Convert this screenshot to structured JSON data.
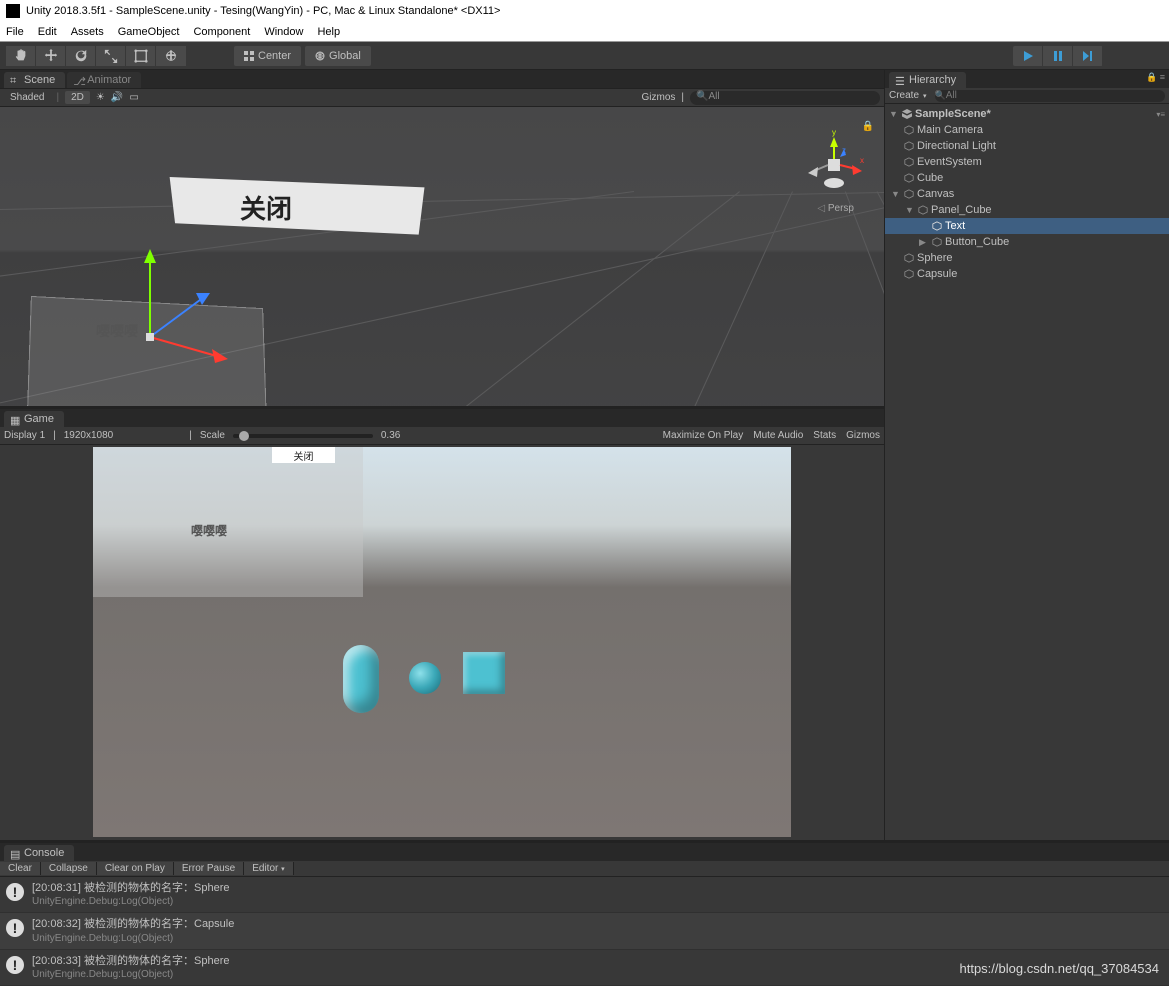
{
  "window": {
    "title": "Unity 2018.3.5f1 - SampleScene.unity - Tesing(WangYin) - PC, Mac & Linux Standalone* <DX11>"
  },
  "menu": {
    "file": "File",
    "edit": "Edit",
    "assets": "Assets",
    "gameobject": "GameObject",
    "component": "Component",
    "window": "Window",
    "help": "Help"
  },
  "toolbar": {
    "center": "Center",
    "global": "Global"
  },
  "tabs": {
    "scene": "Scene",
    "animator": "Animator",
    "game": "Game",
    "hierarchy": "Hierarchy",
    "console": "Console"
  },
  "scene_toolbar": {
    "shaded": "Shaded",
    "twoD": "2D",
    "gizmos": "Gizmos",
    "all_placeholder": "All",
    "persp": "Persp"
  },
  "scene_content": {
    "close_button": "关闭",
    "panel_text": "嘤嘤嘤"
  },
  "game_toolbar": {
    "display": "Display 1",
    "resolution": "1920x1080",
    "scale_label": "Scale",
    "scale_value": "0.36",
    "maximize": "Maximize On Play",
    "mute": "Mute Audio",
    "stats": "Stats",
    "gizmos": "Gizmos"
  },
  "game_content": {
    "close_button": "关闭",
    "panel_text": "嘤嘤嘤"
  },
  "hierarchy_toolbar": {
    "create": "Create",
    "all_placeholder": "All"
  },
  "hierarchy": {
    "scene": "SampleScene*",
    "items": [
      {
        "name": "Main Camera"
      },
      {
        "name": "Directional Light"
      },
      {
        "name": "EventSystem"
      },
      {
        "name": "Cube"
      },
      {
        "name": "Canvas"
      },
      {
        "name": "Panel_Cube"
      },
      {
        "name": "Text"
      },
      {
        "name": "Button_Cube"
      },
      {
        "name": "Sphere"
      },
      {
        "name": "Capsule"
      }
    ]
  },
  "console_toolbar": {
    "clear": "Clear",
    "collapse": "Collapse",
    "clear_on_play": "Clear on Play",
    "error_pause": "Error Pause",
    "editor": "Editor"
  },
  "console": {
    "logs": [
      {
        "time": "[20:08:31]",
        "msg": "被检测的物体的名字：Sphere",
        "src": "UnityEngine.Debug:Log(Object)"
      },
      {
        "time": "[20:08:32]",
        "msg": "被检测的物体的名字：Capsule",
        "src": "UnityEngine.Debug:Log(Object)"
      },
      {
        "time": "[20:08:33]",
        "msg": "被检测的物体的名字：Sphere",
        "src": "UnityEngine.Debug:Log(Object)"
      }
    ]
  },
  "watermark": "https://blog.csdn.net/qq_37084534"
}
